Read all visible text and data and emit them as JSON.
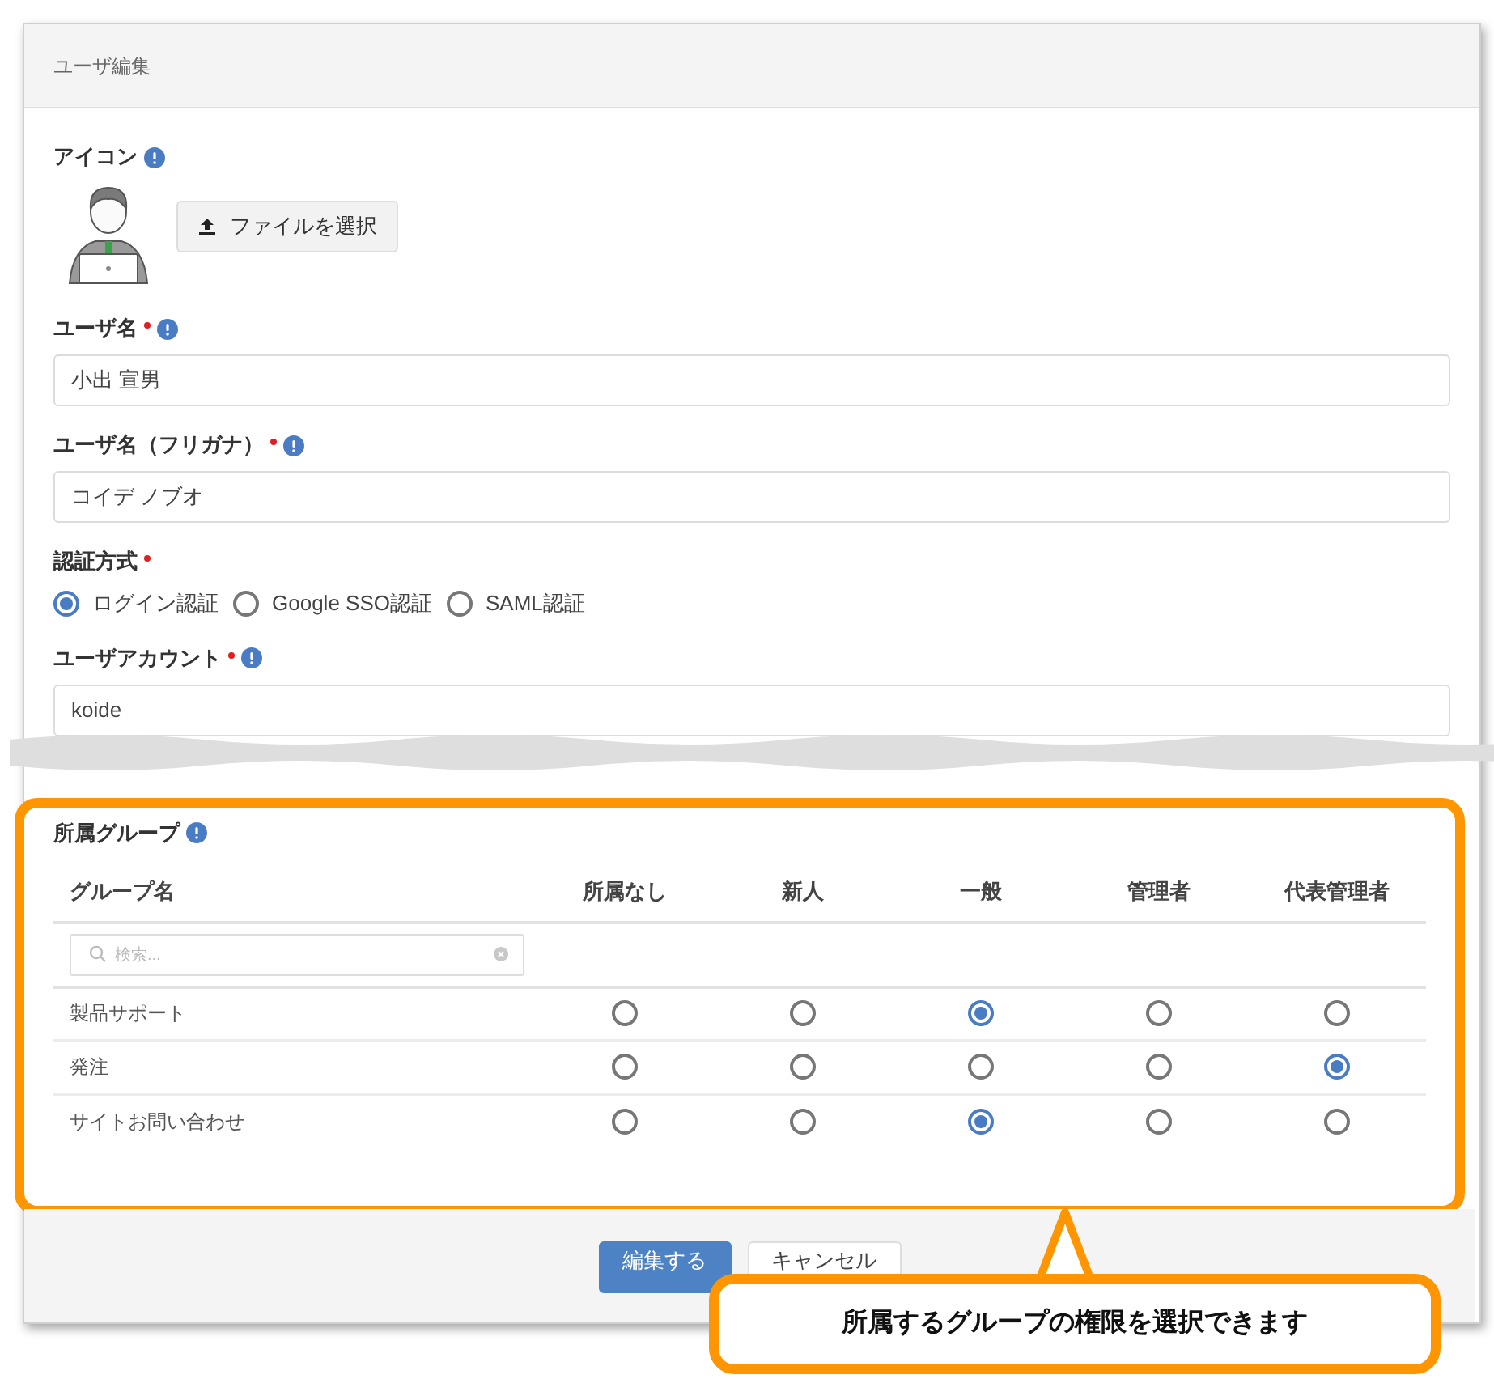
{
  "window": {
    "title": "ユーザ編集"
  },
  "icon_field": {
    "label": "アイコン",
    "info": true,
    "button": "ファイルを選択"
  },
  "fields": [
    {
      "kind": "text",
      "label": "ユーザ名",
      "required": true,
      "info": true,
      "value": "小出 宣男"
    },
    {
      "kind": "text",
      "label": "ユーザ名（フリガナ）",
      "required": true,
      "info": true,
      "value": "コイデ ノブオ"
    },
    {
      "kind": "radio",
      "label": "認証方式",
      "required": true,
      "info": false,
      "options": [
        {
          "label": "ログイン認証",
          "selected": true
        },
        {
          "label": "Google SSO認証",
          "selected": false
        },
        {
          "label": "SAML認証",
          "selected": false
        }
      ]
    },
    {
      "kind": "text",
      "label": "ユーザアカウント",
      "required": true,
      "info": true,
      "value": "koide"
    }
  ],
  "groups": {
    "label": "所属グループ",
    "info": true,
    "columns": [
      "グループ名",
      "所属なし",
      "新人",
      "一般",
      "管理者",
      "代表管理者"
    ],
    "search": {
      "placeholder": "検索..."
    },
    "rows": [
      {
        "name": "製品サポート",
        "cells": [
          {
            "selected": false
          },
          {
            "selected": false
          },
          {
            "selected": true
          },
          {
            "selected": false
          },
          {
            "selected": false
          }
        ]
      },
      {
        "name": "発注",
        "cells": [
          {
            "selected": false
          },
          {
            "selected": false
          },
          {
            "selected": false
          },
          {
            "selected": false
          },
          {
            "selected": true
          }
        ]
      },
      {
        "name": "サイトお問い合わせ",
        "cells": [
          {
            "selected": false
          },
          {
            "selected": false
          },
          {
            "selected": true
          },
          {
            "selected": false
          },
          {
            "selected": false
          }
        ]
      }
    ]
  },
  "buttons": [
    {
      "label": "編集する",
      "kind": "primary"
    },
    {
      "label": "キャンセル",
      "kind": "secondary"
    }
  ],
  "callout": {
    "text": "所属するグループの権限を選択できます"
  }
}
